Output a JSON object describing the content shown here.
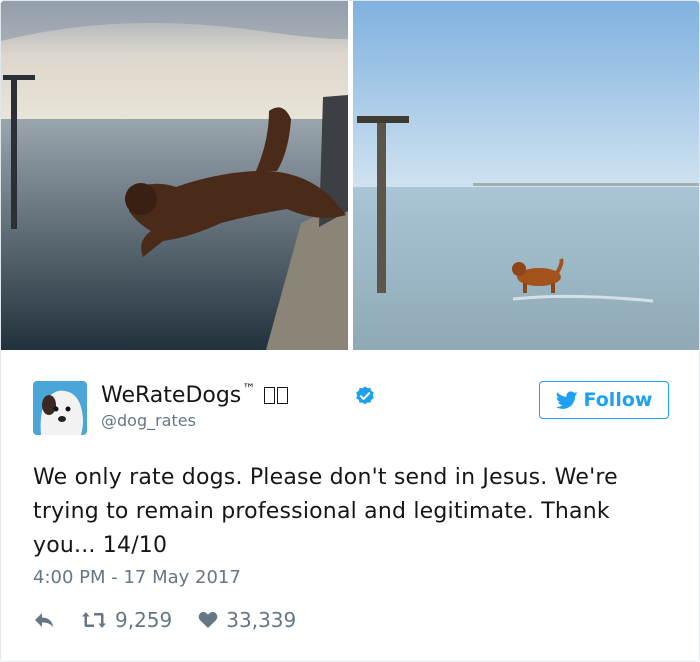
{
  "tweet": {
    "display_name": "WeRateDogs",
    "trademark": "™",
    "handle": "@dog_rates",
    "follow_label": "Follow",
    "text": "We only rate dogs. Please don't send in Jesus. We're trying to remain professional and legitimate. Thank you... 14/10",
    "timestamp": "4:00 PM - 17 May 2017",
    "retweets": "9,259",
    "likes": "33,339"
  },
  "icons": {
    "verified": "verified-badge-icon",
    "follow_bird": "twitter-bird-icon",
    "reply": "reply-icon",
    "retweet": "retweet-icon",
    "like": "heart-icon"
  },
  "colors": {
    "brand_blue": "#1da1f2",
    "secondary_text": "#657786",
    "primary_text": "#14171a",
    "border": "#e1e8ed"
  }
}
